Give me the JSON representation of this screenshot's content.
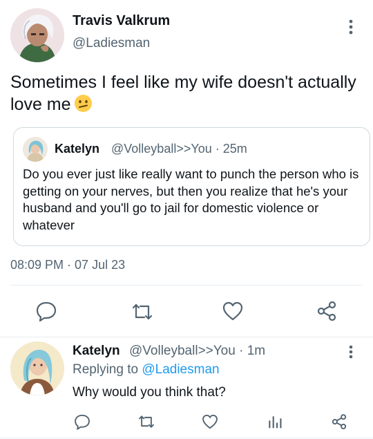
{
  "main_tweet": {
    "author_name": "Travis Valkrum",
    "author_handle": "@Ladiesman",
    "text": "Sometimes I feel like my wife doesn't actually love me",
    "emoji": "confused-face",
    "timestamp": "08:09 PM · 07 Jul 23",
    "actions": [
      "reply-icon",
      "retweet-icon",
      "like-icon",
      "share-icon"
    ]
  },
  "quoted_tweet": {
    "author_name": "Katelyn",
    "meta": "@Volleyball>>You · 25m",
    "text": "Do you ever just like really want to punch the person who is getting on your nerves, but then you realize that he's your husband and you'll go to jail for domestic violence or whatever"
  },
  "reply": {
    "author_name": "Katelyn",
    "meta": "@Volleyball>>You · 1m",
    "replying_to_label": "Replying to",
    "replying_to_handle": "@Ladiesman",
    "text": "Why would you think that?",
    "actions": [
      "reply-icon",
      "retweet-icon",
      "like-icon",
      "analytics-icon",
      "share-icon"
    ]
  },
  "colors": {
    "text_primary": "#0f1419",
    "text_secondary": "#536471",
    "link": "#1d9bf0",
    "divider": "#e6ecf0",
    "border": "#cfd9de"
  }
}
